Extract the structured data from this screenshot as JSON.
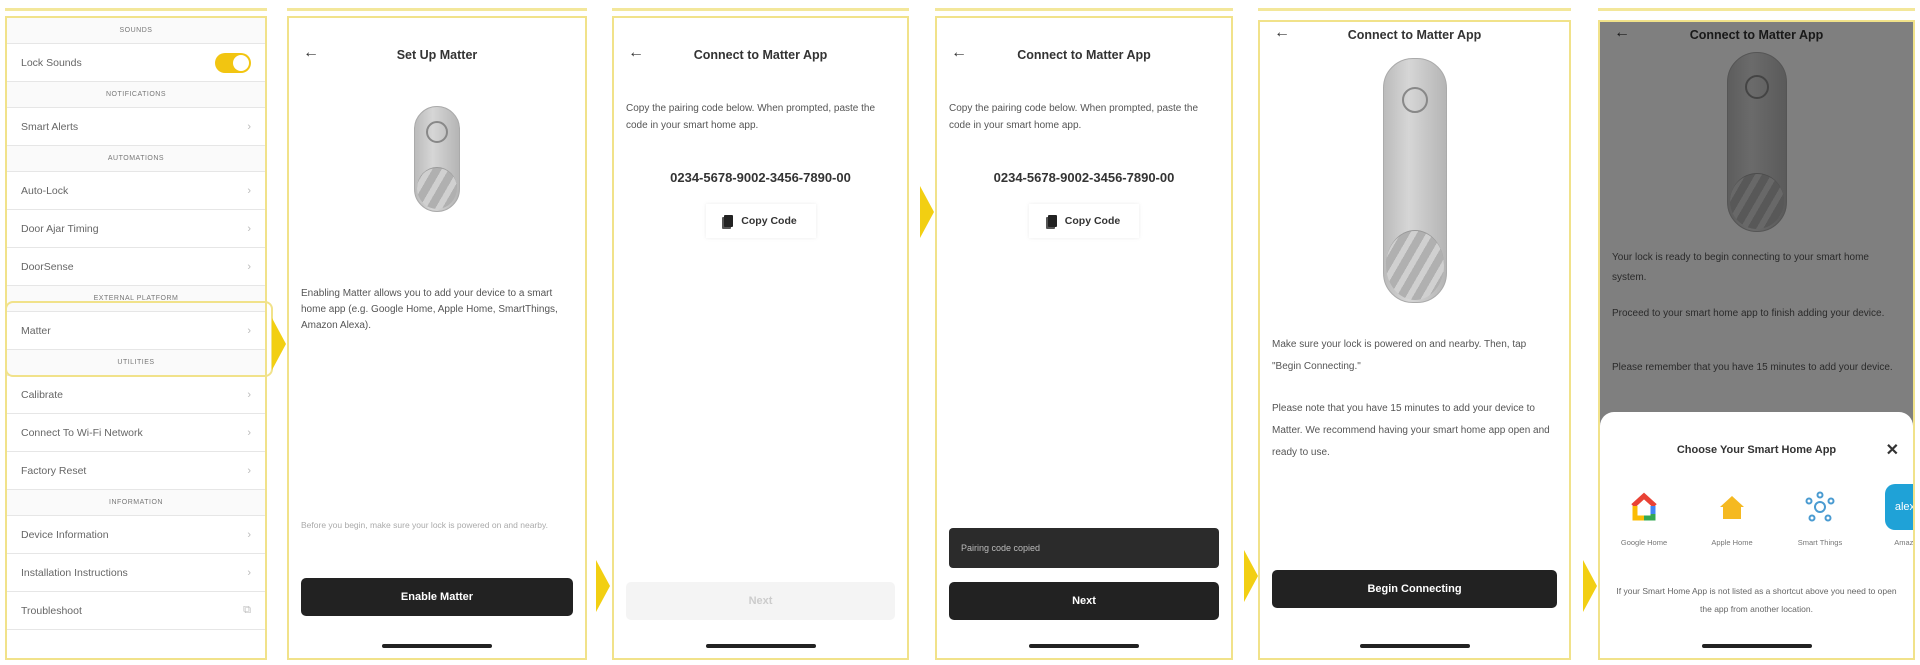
{
  "settings": {
    "sections": [
      {
        "header": "SOUNDS",
        "rows": [
          {
            "label": "Lock Sounds",
            "type": "toggle",
            "on": true
          }
        ]
      },
      {
        "header": "NOTIFICATIONS",
        "rows": [
          {
            "label": "Smart Alerts",
            "type": "chevron"
          }
        ]
      },
      {
        "header": "AUTOMATIONS",
        "rows": [
          {
            "label": "Auto-Lock",
            "type": "chevron"
          },
          {
            "label": "Door Ajar Timing",
            "type": "chevron"
          },
          {
            "label": "DoorSense",
            "type": "chevron"
          }
        ]
      },
      {
        "header": "EXTERNAL PLATFORM",
        "rows": [
          {
            "label": "Matter",
            "type": "chevron"
          }
        ]
      },
      {
        "header": "UTILITIES",
        "rows": [
          {
            "label": "Calibrate",
            "type": "chevron"
          },
          {
            "label": "Connect To Wi-Fi Network",
            "type": "chevron"
          },
          {
            "label": "Factory Reset",
            "type": "chevron"
          }
        ]
      },
      {
        "header": "INFORMATION",
        "rows": [
          {
            "label": "Device Information",
            "type": "chevron"
          },
          {
            "label": "Installation Instructions",
            "type": "chevron"
          },
          {
            "label": "Troubleshoot",
            "type": "external"
          }
        ]
      }
    ]
  },
  "setup": {
    "title": "Set Up Matter",
    "description": "Enabling Matter allows you to add your device to a smart home app (e.g. Google Home, Apple Home, SmartThings, Amazon Alexa).",
    "note": "Before you begin, make sure your lock is powered on and nearby.",
    "button": "Enable Matter"
  },
  "connect": {
    "title": "Connect to Matter App",
    "instructions": "Copy the pairing code below. When prompted, paste the code in your smart home app.",
    "code": "0234-5678-9002-3456-7890-00",
    "copy_label": "Copy Code",
    "next_label": "Next",
    "toast": "Pairing code copied"
  },
  "begin": {
    "title": "Connect to Matter App",
    "text1": "Make sure your lock is powered on and nearby. Then, tap \"Begin Connecting.\"",
    "text2": "Please note that you have 15 minutes to add your device to Matter. We recommend having your smart home app open and ready to use.",
    "button": "Begin Connecting"
  },
  "choose": {
    "title": "Connect to Matter App",
    "text1": "Your lock is ready to begin connecting to your smart home system.",
    "text2": "Proceed to your smart home app to finish adding your device.",
    "text3": "Please remember that you have 15 minutes to add your device.",
    "sheet_title": "Choose Your Smart Home App",
    "apps": [
      {
        "label": "Google Home",
        "icon": "google-home-icon"
      },
      {
        "label": "Apple Home",
        "icon": "apple-home-icon"
      },
      {
        "label": "Smart Things",
        "icon": "smartthings-icon"
      },
      {
        "label": "Amazon",
        "icon": "alexa-icon"
      }
    ],
    "footer": "If your Smart Home App is not listed as a shortcut above you need to open the app from another location."
  },
  "colors": {
    "accent": "#f2c511",
    "button": "#222222"
  }
}
